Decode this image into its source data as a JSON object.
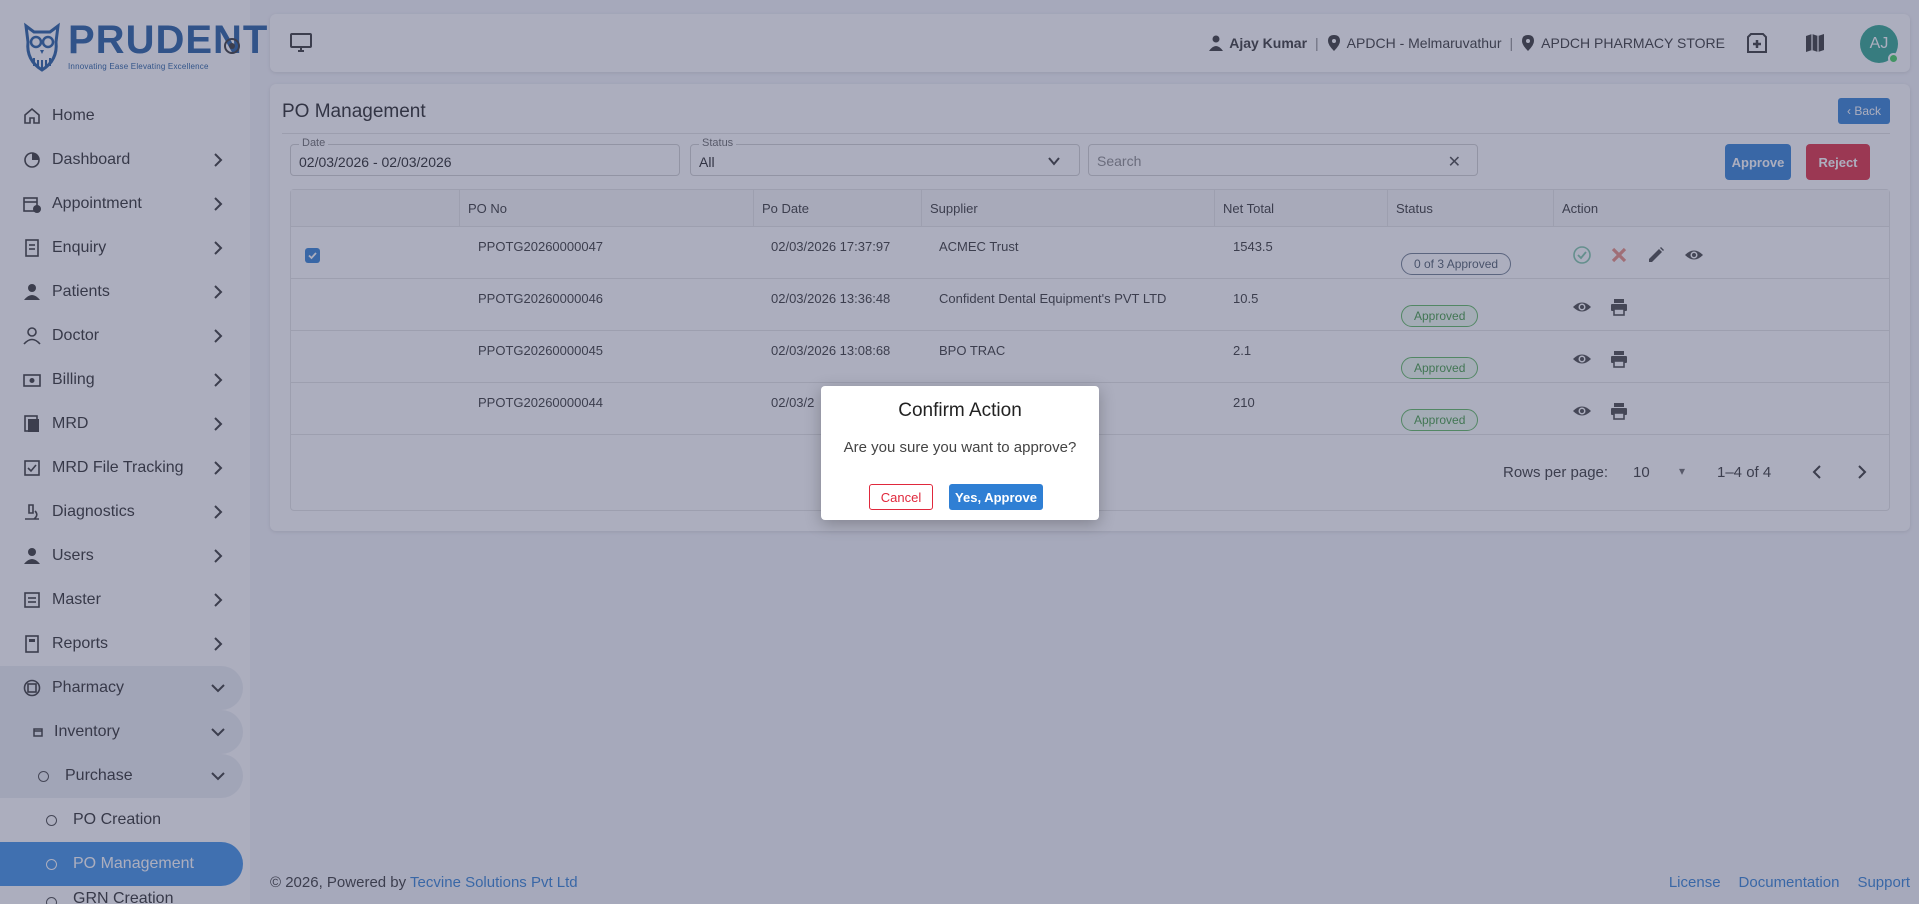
{
  "app": {
    "logo_name": "PRUDENT",
    "logo_tagline": "Innovating Ease Elevating Excellence"
  },
  "sidebar": {
    "items": [
      {
        "label": "Home",
        "icon": "home-icon"
      },
      {
        "label": "Dashboard",
        "icon": "dashboard-icon"
      },
      {
        "label": "Appointment",
        "icon": "calendar-clock-icon"
      },
      {
        "label": "Enquiry",
        "icon": "enquiry-icon"
      },
      {
        "label": "Patients",
        "icon": "person-icon"
      },
      {
        "label": "Doctor",
        "icon": "doctor-icon"
      },
      {
        "label": "Billing",
        "icon": "billing-icon"
      },
      {
        "label": "MRD",
        "icon": "mrd-icon"
      },
      {
        "label": "MRD File Tracking",
        "icon": "file-tracking-icon"
      },
      {
        "label": "Diagnostics",
        "icon": "microscope-icon"
      },
      {
        "label": "Users",
        "icon": "user-icon"
      },
      {
        "label": "Master",
        "icon": "master-icon"
      },
      {
        "label": "Reports",
        "icon": "reports-icon"
      },
      {
        "label": "Pharmacy",
        "icon": "pharmacy-icon"
      },
      {
        "label": "Inventory",
        "icon": "inventory-icon"
      },
      {
        "label": "Purchase",
        "icon": "circle-icon"
      },
      {
        "label": "PO Creation",
        "icon": "circle-icon"
      },
      {
        "label": "PO Management",
        "icon": "circle-icon"
      },
      {
        "label": "GRN Creation",
        "icon": "circle-icon"
      }
    ]
  },
  "topbar": {
    "user": "Ajay Kumar",
    "branch": "APDCH - Melmaruvathur",
    "store": "APDCH PHARMACY STORE",
    "avatar_initials": "AJ"
  },
  "page": {
    "title": "PO Management",
    "back_label": "‹ Back",
    "approve_label": "Approve",
    "reject_label": "Reject"
  },
  "filters": {
    "date_label": "Date",
    "date_value": "02/03/2026 - 02/03/2026",
    "status_label": "Status",
    "status_value": "All",
    "search_placeholder": "Search",
    "clear_symbol": "✕"
  },
  "table": {
    "columns": [
      "PO No",
      "Po Date",
      "Supplier",
      "Net Total",
      "Status",
      "Action"
    ],
    "rows": [
      {
        "po_no": "PPOTG20260000047",
        "po_date": "02/03/2026 17:37:97",
        "supplier": "ACMEC Trust",
        "net_total": "1543.5",
        "status": "0 of 3 Approved",
        "status_type": "pending",
        "checked": true
      },
      {
        "po_no": "PPOTG20260000046",
        "po_date": "02/03/2026 13:36:48",
        "supplier": "Confident Dental Equipment's PVT LTD",
        "net_total": "10.5",
        "status": "Approved",
        "status_type": "approved",
        "checked": false
      },
      {
        "po_no": "PPOTG20260000045",
        "po_date": "02/03/2026 13:08:68",
        "supplier": "BPO TRAC",
        "net_total": "2.1",
        "status": "Approved",
        "status_type": "approved",
        "checked": false
      },
      {
        "po_no": "PPOTG20260000044",
        "po_date": "02/03/2",
        "supplier": "",
        "net_total": "210",
        "status": "Approved",
        "status_type": "approved",
        "checked": false
      }
    ],
    "pagination": {
      "rows_per_page_label": "Rows per page:",
      "rows_per_page": "10",
      "range": "1–4 of 4"
    }
  },
  "footer": {
    "copyright": "© 2026, Powered by ",
    "company": "Tecvine Solutions Pvt Ltd",
    "links": [
      "License",
      "Documentation",
      "Support"
    ]
  },
  "dialog": {
    "title": "Confirm Action",
    "message": "Are you sure you want to approve?",
    "cancel_label": "Cancel",
    "confirm_label": "Yes, Approve"
  },
  "colors": {
    "primary": "#2f7fd4",
    "danger": "#e0283c",
    "success": "#5cb85c",
    "brand": "#1f5a9e",
    "active_menu": "#3b8fe6"
  }
}
